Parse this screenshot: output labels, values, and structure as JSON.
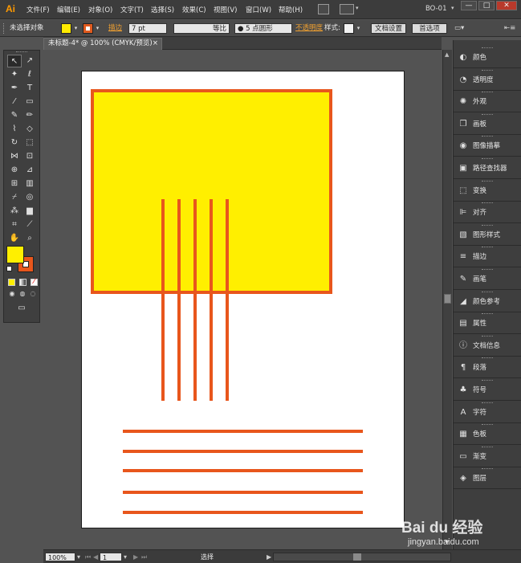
{
  "app": {
    "logo": "Ai",
    "menus": [
      "文件(F)",
      "编辑(E)",
      "对象(O)",
      "文字(T)",
      "选择(S)",
      "效果(C)",
      "视图(V)",
      "窗口(W)",
      "帮助(H)"
    ],
    "workspace": "BO-01",
    "window_buttons": [
      "—",
      "□",
      "✕"
    ]
  },
  "control_bar": {
    "selection_status": "未选择对象",
    "fill_color": "#ffea00",
    "stroke_color": "#e05a1e",
    "stroke_label": "描边",
    "stroke_weight": "7 pt",
    "profile_label": "等比",
    "brush_label": "● 5 点圆形",
    "opacity_label": "不透明度",
    "style_label": "样式:",
    "doc_setup_button": "文档设置",
    "preferences_button": "首选项"
  },
  "document_tab": {
    "title": "未标题-4* @ 100% (CMYK/预览)",
    "close": "×"
  },
  "artwork": {
    "square_fill": "#ffef00",
    "stroke_color": "#e8561c",
    "vertical_lines": 5,
    "horizontal_lines": 5
  },
  "panels": [
    {
      "name": "颜色",
      "icon": "color-icon",
      "glyph": "◐"
    },
    {
      "name": "透明度",
      "icon": "transparency-icon",
      "glyph": "◔"
    },
    {
      "name": "外观",
      "icon": "appearance-icon",
      "glyph": "✺"
    },
    {
      "name": "画板",
      "icon": "artboards-icon",
      "glyph": "❐"
    },
    {
      "name": "图像描摹",
      "icon": "image-trace-icon",
      "glyph": "◉"
    },
    {
      "name": "路径查找器",
      "icon": "pathfinder-icon",
      "glyph": "▣"
    },
    {
      "name": "变换",
      "icon": "transform-icon",
      "glyph": "⬚"
    },
    {
      "name": "对齐",
      "icon": "align-icon",
      "glyph": "⊫"
    },
    {
      "name": "图形样式",
      "icon": "graphic-styles-icon",
      "glyph": "▧"
    },
    {
      "name": "描边",
      "icon": "stroke-icon",
      "glyph": "≡"
    },
    {
      "name": "画笔",
      "icon": "brushes-icon",
      "glyph": "✎"
    },
    {
      "name": "颜色参考",
      "icon": "color-guide-icon",
      "glyph": "◢"
    },
    {
      "name": "属性",
      "icon": "attributes-icon",
      "glyph": "▤"
    },
    {
      "name": "文档信息",
      "icon": "document-info-icon",
      "glyph": "ⓘ"
    },
    {
      "name": "段落",
      "icon": "paragraph-icon",
      "glyph": "¶"
    },
    {
      "name": "符号",
      "icon": "symbols-icon",
      "glyph": "♣"
    },
    {
      "name": "字符",
      "icon": "character-icon",
      "glyph": "A"
    },
    {
      "name": "色板",
      "icon": "swatches-icon",
      "glyph": "▦"
    },
    {
      "name": "渐变",
      "icon": "gradient-icon",
      "glyph": "▭"
    },
    {
      "name": "图层",
      "icon": "layers-icon",
      "glyph": "◈"
    }
  ],
  "status_bar": {
    "zoom": "100%",
    "artboard_number": "1",
    "tool_status": "选择"
  },
  "watermark": {
    "brand": "Bai du 经验",
    "url": "jingyan.baidu.com"
  }
}
